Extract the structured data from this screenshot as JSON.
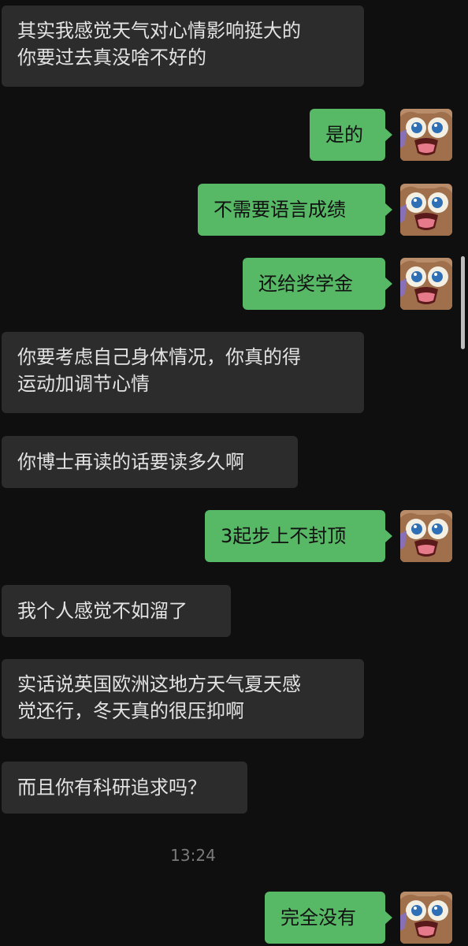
{
  "messages": [
    {
      "side": "in",
      "text": "其实我感觉天气对心情影响挺大的\n你要过去真没啥不好的"
    },
    {
      "side": "out",
      "text": "是的"
    },
    {
      "side": "out",
      "text": "不需要语言成绩"
    },
    {
      "side": "out",
      "text": "还给奖学金"
    },
    {
      "side": "in",
      "text": "你要考虑自己身体情况，你真的得\n运动加调节心情"
    },
    {
      "side": "in",
      "text": "你博士再读的话要读多久啊"
    },
    {
      "side": "out",
      "text": "3起步上不封顶"
    },
    {
      "side": "in",
      "text": "我个人感觉不如溜了"
    },
    {
      "side": "in",
      "text": "实话说英国欧洲这地方天气夏天感\n觉还行，冬天真的很压抑啊"
    },
    {
      "side": "in",
      "text": "而且你有科研追求吗？"
    },
    {
      "side": "out",
      "text": "完全没有"
    }
  ],
  "timestamp": "13:24",
  "avatar_icon": "cartoon-face-avatar",
  "colors": {
    "background": "#0f0f0f",
    "incoming_bubble": "#2c2c2c",
    "outgoing_bubble": "#57b865"
  }
}
